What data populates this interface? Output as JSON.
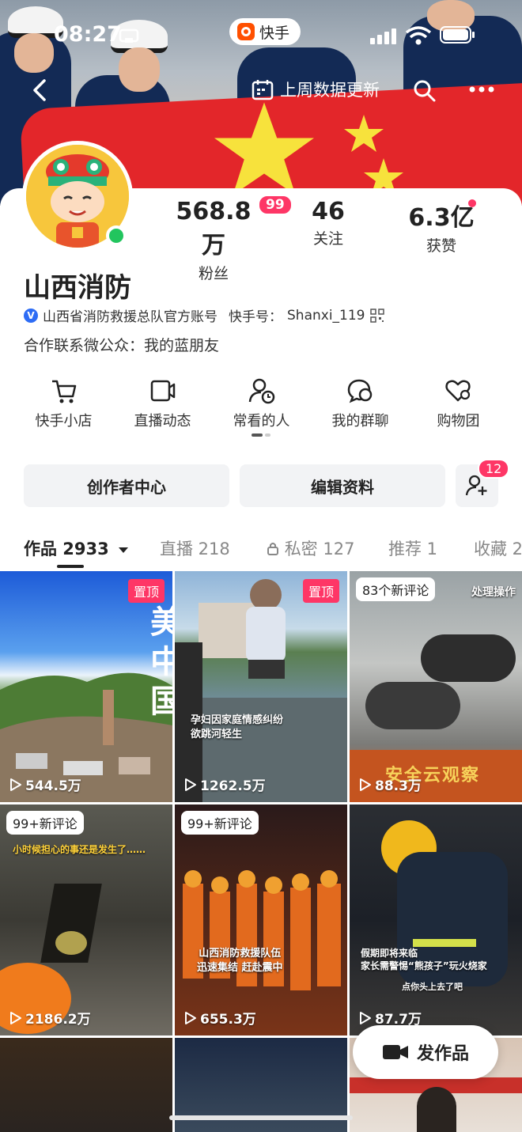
{
  "status_bar": {
    "time": "08:27",
    "app_name": "快手"
  },
  "header": {
    "update_label": "上周数据更新"
  },
  "profile": {
    "name": "山西消防",
    "verified_text": "山西省消防救援总队官方账号",
    "kwai_id_label": "快手号：",
    "kwai_id": "Shanxi_119",
    "bio": "合作联系微公众：我的蓝朋友"
  },
  "stats": [
    {
      "value": "568.8万",
      "label": "粉丝",
      "badge": "99"
    },
    {
      "value": "46",
      "label": "关注"
    },
    {
      "value": "6.3亿",
      "label": "获赞"
    }
  ],
  "shortcuts": [
    {
      "label": "快手小店",
      "icon": "cart-icon"
    },
    {
      "label": "直播动态",
      "icon": "video-camera-icon"
    },
    {
      "label": "常看的人",
      "icon": "person-clock-icon"
    },
    {
      "label": "我的群聊",
      "icon": "group-chat-icon"
    },
    {
      "label": "购物团",
      "icon": "heart-shopping-icon"
    }
  ],
  "actions": {
    "creator_center": "创作者中心",
    "edit_profile": "编辑资料",
    "add_friend_badge": "12"
  },
  "tabs": [
    {
      "label": "作品 2933"
    },
    {
      "label": "直播 218"
    },
    {
      "label": "私密 127"
    },
    {
      "label": "推荐 1"
    },
    {
      "label": "收藏 2"
    }
  ],
  "videos": [
    {
      "views": "544.5万",
      "tag": "置顶"
    },
    {
      "views": "1262.5万",
      "tag": "置顶",
      "caption": "孕妇因家庭情感纠纷\n欲跳河轻生"
    },
    {
      "views": "88.3万",
      "comments": "83个新评论",
      "caption_top": "处理操作",
      "caption_bottom": "安全云观察"
    },
    {
      "views": "2186.2万",
      "comments": "99+新评论",
      "caption": "小时候担心的事还是发生了……"
    },
    {
      "views": "655.3万",
      "comments": "99+新评论",
      "caption": "山西消防救援队伍\n迅速集结 赶赴震中"
    },
    {
      "views": "87.7万",
      "caption": "假期即将来临\n家长需警惕“熊孩子”玩火烧家",
      "caption2": "点你头上去了吧"
    }
  ],
  "publish_button": "发作品",
  "colors": {
    "accent": "#fe3666",
    "online": "#22c55e",
    "verify": "#2d6cf5"
  }
}
